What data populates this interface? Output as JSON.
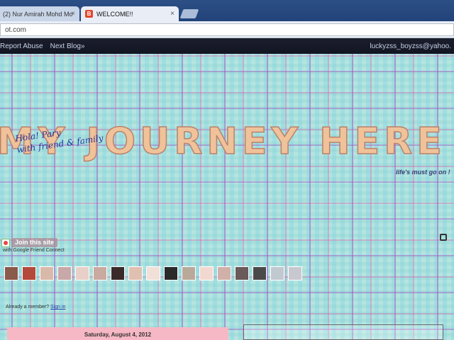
{
  "browser": {
    "tabs": [
      {
        "label": "(2) Nur Amirah Mohd Mo",
        "close": "×"
      },
      {
        "label": "WELCOME!!",
        "close": "×",
        "favicon": "B"
      }
    ],
    "address": "ot.com"
  },
  "navbar": {
    "report_abuse": "Report Abuse",
    "next_blog": "Next Blog»",
    "user_email": "luckyzss_boyzss@yahoo."
  },
  "blog": {
    "title": "MY JOURNEY HERE",
    "handwriting_line1": "Hola!  Pary",
    "handwriting_line2": "with  friend & family",
    "subtitle": "life's must go on !"
  },
  "followers": {
    "join_label": "Join this site",
    "gfc_text": "with Google Friend Connect",
    "avatar_colors": [
      "#8a5a4a",
      "#b44a3a",
      "#d9b9a9",
      "#c8a8a8",
      "#e8d0c8",
      "#c9a9a0",
      "#3a2a2a",
      "#e0c0b0",
      "#f0e0d8",
      "#2a2a2a",
      "#b9a99a",
      "#f2d8d0",
      "#d0b0a8",
      "#6a5a5a",
      "#4a4a4a",
      "#c0c8d0",
      "#c8c8d0"
    ],
    "already_member": "Already a member?",
    "sign_in": "Sign in"
  },
  "post": {
    "date": "Saturday, August 4, 2012"
  }
}
